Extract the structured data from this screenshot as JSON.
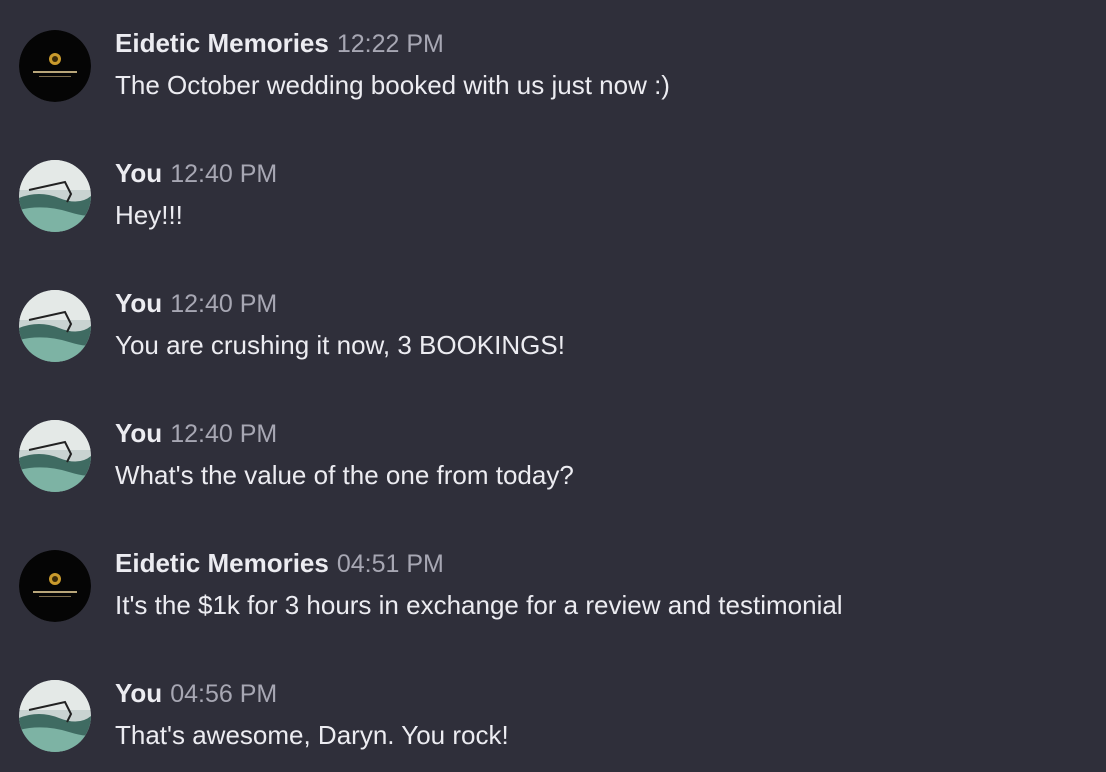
{
  "messages": [
    {
      "sender": "Eidetic Memories",
      "time": "12:22 PM",
      "text": "The October wedding booked with us just now :)",
      "avatar": "eidetic-logo"
    },
    {
      "sender": "You",
      "time": "12:40 PM",
      "text": "Hey!!!",
      "avatar": "photo"
    },
    {
      "sender": "You",
      "time": "12:40 PM",
      "text": "You are crushing it now, 3 BOOKINGS!",
      "avatar": "photo"
    },
    {
      "sender": "You",
      "time": "12:40 PM",
      "text": "What's the value of the one from today?",
      "avatar": "photo"
    },
    {
      "sender": "Eidetic Memories",
      "time": "04:51 PM",
      "text": "It's the $1k for 3 hours in exchange for a review and testimonial",
      "avatar": "eidetic-logo"
    },
    {
      "sender": "You",
      "time": "04:56 PM",
      "text": "That's awesome, Daryn. You rock!",
      "avatar": "photo"
    }
  ],
  "colors": {
    "background": "#2f2f3a",
    "name": "#ececf1",
    "timestamp": "#a7a7b3",
    "text": "#ececf1"
  }
}
